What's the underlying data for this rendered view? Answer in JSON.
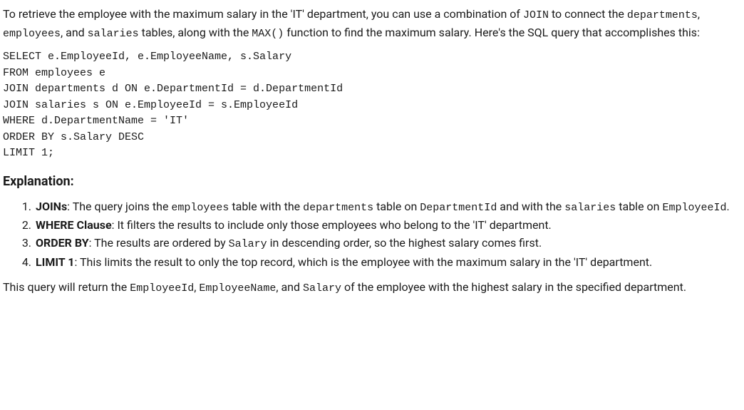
{
  "intro": {
    "p1_a": "To retrieve the employee with the maximum salary in the 'IT' department, you can use a combination of ",
    "code1": "JOIN",
    "p1_b": " to connect the ",
    "code2": "departments",
    "p1_c": ", ",
    "code3": "employees",
    "p1_d": ", and ",
    "code4": "salaries",
    "p1_e": " tables, along with the ",
    "code5": "MAX()",
    "p1_f": " function to find the maximum salary. Here's the SQL query that accomplishes this:"
  },
  "sql": "SELECT e.EmployeeId, e.EmployeeName, s.Salary\nFROM employees e\nJOIN departments d ON e.DepartmentId = d.DepartmentId\nJOIN salaries s ON e.EmployeeId = s.EmployeeId\nWHERE d.DepartmentName = 'IT'\nORDER BY s.Salary DESC\nLIMIT 1;",
  "explanation_heading": "Explanation:",
  "items": [
    {
      "title": "JOINs",
      "t1": ": The query joins the ",
      "c1": "employees",
      "t2": " table with the ",
      "c2": "departments",
      "t3": " table on ",
      "c3": "DepartmentId",
      "t4": " and with the ",
      "c4": "salaries",
      "t5": " table on ",
      "c5": "EmployeeId",
      "t6": "."
    },
    {
      "title": "WHERE Clause",
      "t1": ": It filters the results to include only those employees who belong to the 'IT' department."
    },
    {
      "title": "ORDER BY",
      "t1": ": The results are ordered by ",
      "c1": "Salary",
      "t2": " in descending order, so the highest salary comes first."
    },
    {
      "title": "LIMIT 1",
      "t1": ": This limits the result to only the top record, which is the employee with the maximum salary in the 'IT' department."
    }
  ],
  "closing": {
    "t1": "This query will return the ",
    "c1": "EmployeeId",
    "t2": ", ",
    "c2": "EmployeeName",
    "t3": ", and ",
    "c3": "Salary",
    "t4": " of the employee with the highest salary in the specified department."
  }
}
